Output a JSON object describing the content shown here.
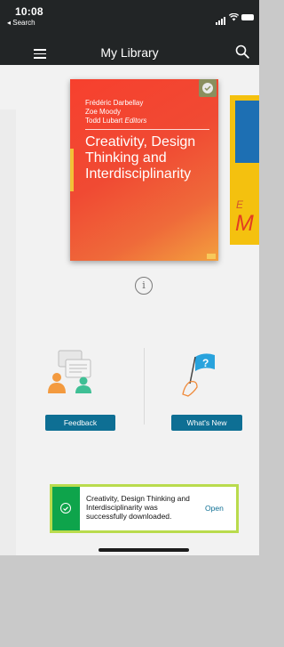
{
  "status_bar": {
    "time": "10:08",
    "back_label": "◂ Search"
  },
  "nav": {
    "title": "My Library"
  },
  "featured_book": {
    "editors": [
      "Frédéric Darbellay",
      "Zoe Moody",
      "Todd Lubart"
    ],
    "editors_suffix": "Editors",
    "title": "Creativity, Design Thinking and Interdisciplinarity"
  },
  "next_book": {
    "letter_e": "E",
    "letter_m": "M"
  },
  "info_button": {
    "glyph": "i"
  },
  "feedback": {
    "label": "Feedback",
    "icon": "people-chat-icon"
  },
  "whats_new": {
    "label": "What's New",
    "icon": "hand-flag-question-icon"
  },
  "toast": {
    "message": "Creativity, Design Thinking and Interdisciplinarity was successfully downloaded.",
    "action": "Open"
  },
  "colors": {
    "nav_bg": "#222526",
    "accent_button": "#0e6f94",
    "toast_green": "#0ea44b",
    "toast_border": "#b9db4d"
  }
}
